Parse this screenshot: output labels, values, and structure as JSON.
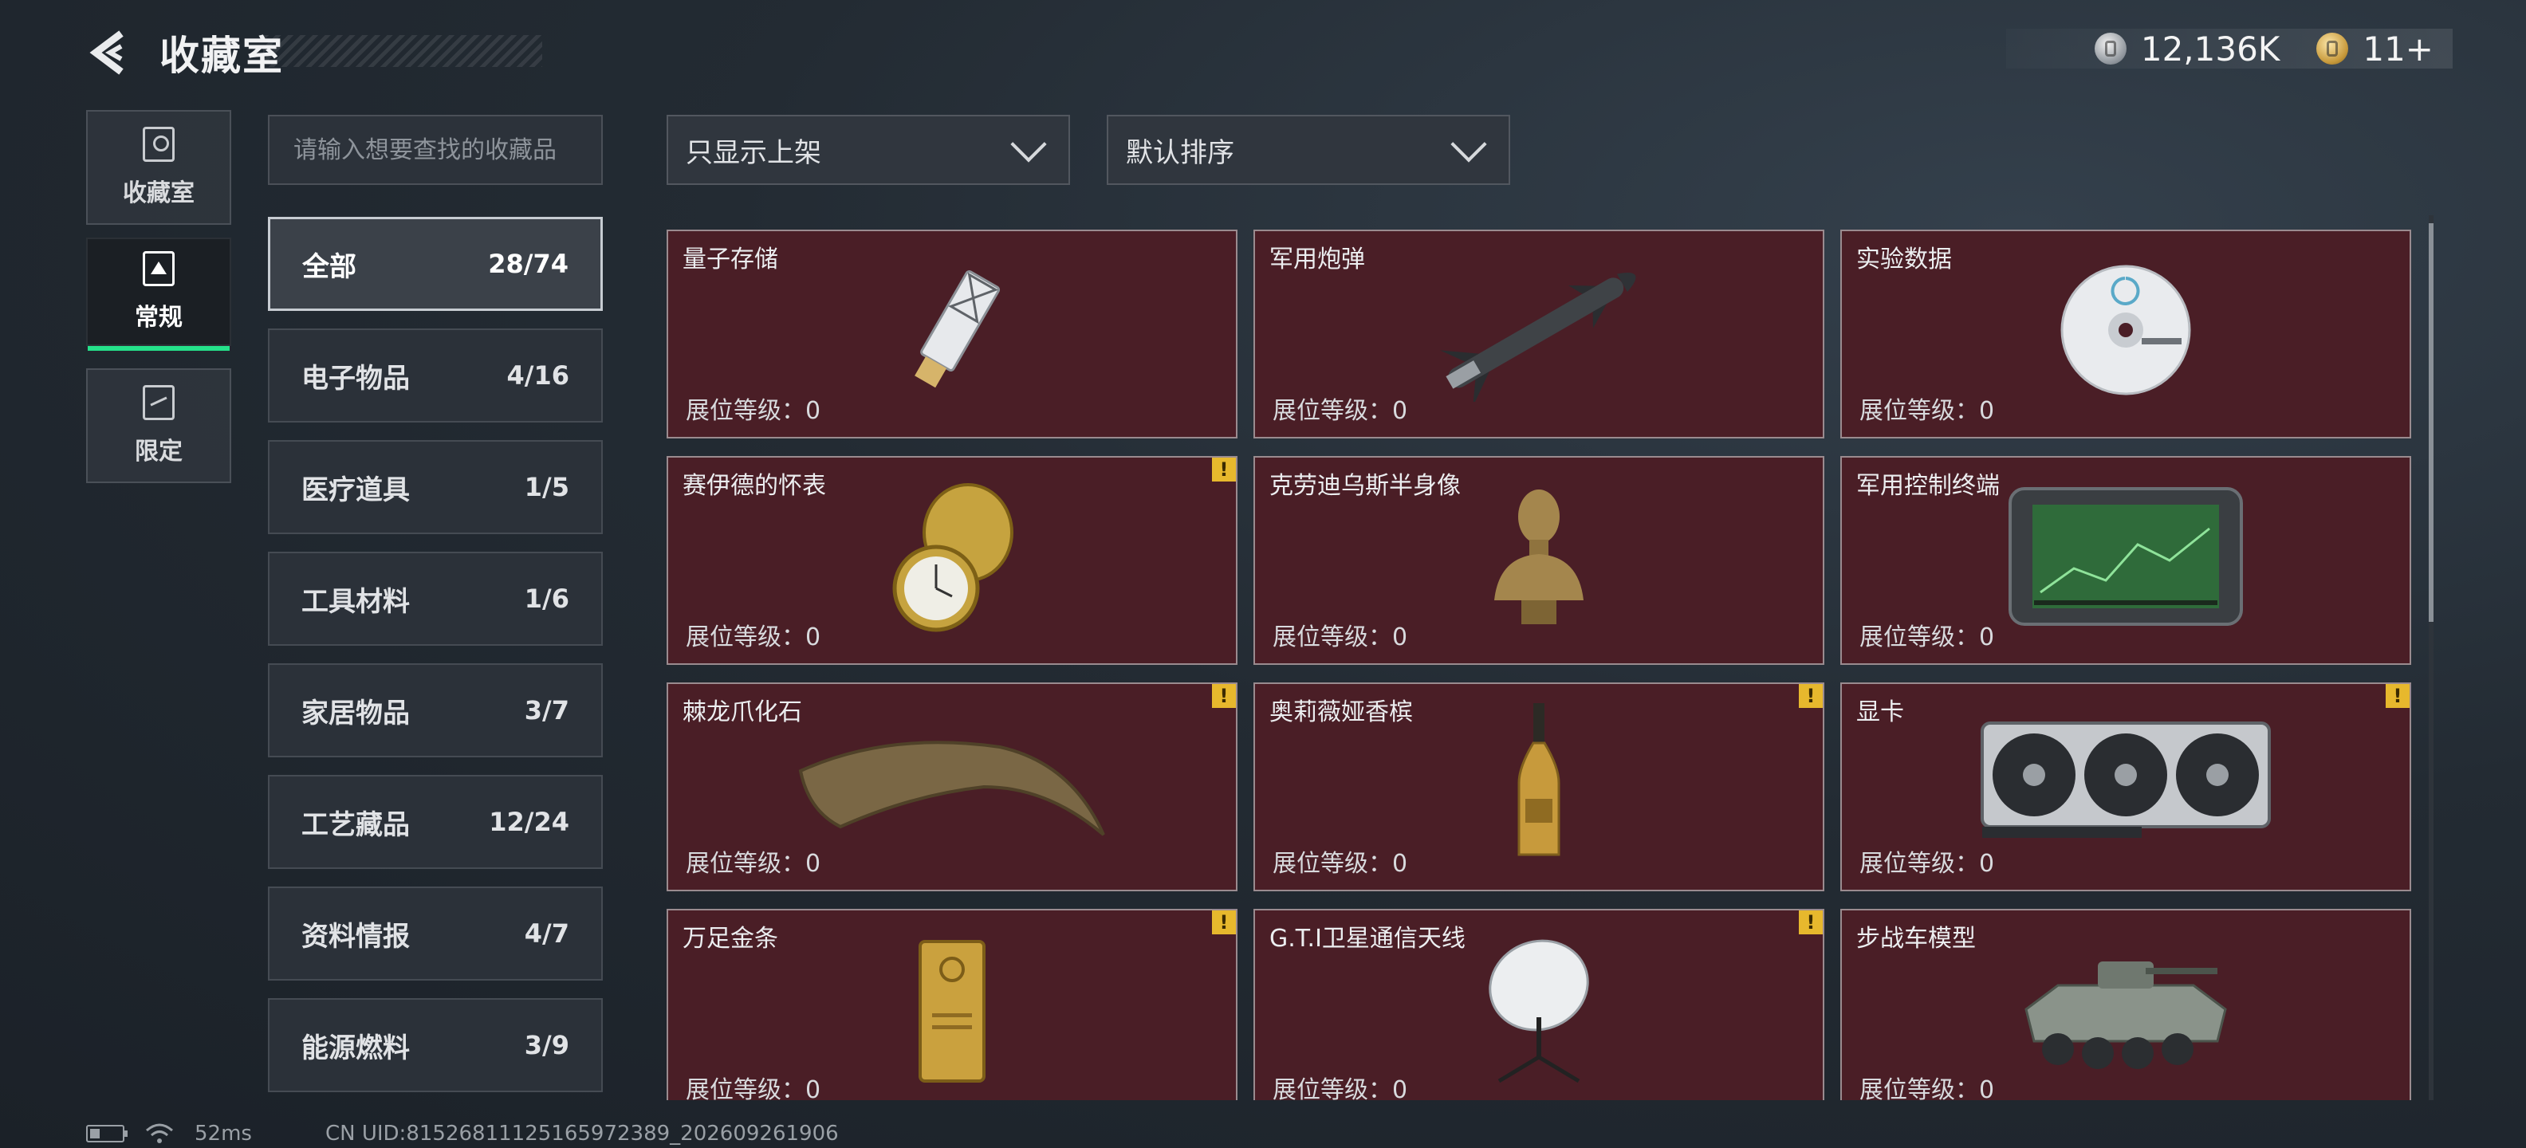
{
  "header": {
    "title": "收藏室"
  },
  "currency": [
    {
      "icon": "silver-coin-icon",
      "value": "12,136K"
    },
    {
      "icon": "gold-coin-icon",
      "value": "11+"
    }
  ],
  "left_rail": [
    {
      "label": "收藏室",
      "icon": "collection-room-icon",
      "active": false
    },
    {
      "label": "常规",
      "icon": "regular-icon",
      "active": true
    },
    {
      "label": "限定",
      "icon": "limited-icon",
      "active": false
    }
  ],
  "search": {
    "placeholder": "请输入想要查找的收藏品"
  },
  "filters": {
    "display": "只显示上架",
    "sort": "默认排序"
  },
  "categories": [
    {
      "name": "全部",
      "count": "28/74",
      "active": true
    },
    {
      "name": "电子物品",
      "count": "4/16"
    },
    {
      "name": "医疗道具",
      "count": "1/5"
    },
    {
      "name": "工具材料",
      "count": "1/6"
    },
    {
      "name": "家居物品",
      "count": "3/7"
    },
    {
      "name": "工艺藏品",
      "count": "12/24"
    },
    {
      "name": "资料情报",
      "count": "4/7"
    },
    {
      "name": "能源燃料",
      "count": "3/9"
    }
  ],
  "items": [
    {
      "name": "量子存储",
      "level": "展位等级：0",
      "warning": false,
      "icon": "usb-drive-icon"
    },
    {
      "name": "军用炮弹",
      "level": "展位等级：0",
      "warning": false,
      "icon": "missile-icon"
    },
    {
      "name": "实验数据",
      "level": "展位等级：0",
      "warning": false,
      "icon": "disc-icon"
    },
    {
      "name": "赛伊德的怀表",
      "level": "展位等级：0",
      "warning": true,
      "icon": "pocket-watch-icon"
    },
    {
      "name": "克劳迪乌斯半身像",
      "level": "展位等级：0",
      "warning": false,
      "icon": "bust-icon"
    },
    {
      "name": "军用控制终端",
      "level": "展位等级：0",
      "warning": false,
      "icon": "terminal-icon"
    },
    {
      "name": "棘龙爪化石",
      "level": "展位等级：0",
      "warning": true,
      "icon": "claw-fossil-icon"
    },
    {
      "name": "奥莉薇娅香槟",
      "level": "展位等级：0",
      "warning": true,
      "icon": "champagne-icon"
    },
    {
      "name": "显卡",
      "level": "展位等级：0",
      "warning": true,
      "icon": "graphics-card-icon"
    },
    {
      "name": "万足金条",
      "level": "展位等级：0",
      "warning": true,
      "icon": "gold-bar-icon"
    },
    {
      "name": "G.T.I卫星通信天线",
      "level": "展位等级：0",
      "warning": true,
      "icon": "satellite-dish-icon"
    },
    {
      "name": "步战车模型",
      "level": "展位等级：0",
      "warning": false,
      "icon": "ifv-model-icon"
    }
  ],
  "warning_mark": "!",
  "status": {
    "ping": "52ms",
    "uid": "CN UID:815268111251659723​89_202609261906"
  }
}
